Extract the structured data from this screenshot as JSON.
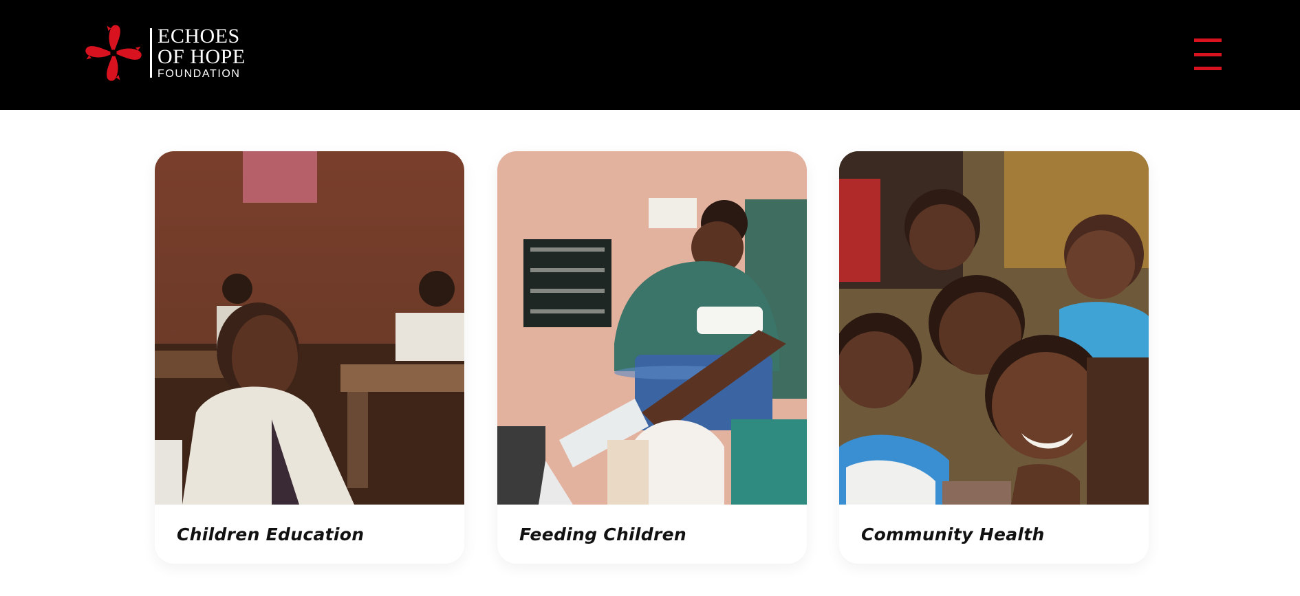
{
  "header": {
    "logo": {
      "line1": "ECHOES",
      "line2": "OF HOPE",
      "line3": "FOUNDATION",
      "icon": "pinwheel-hands-icon",
      "color": "#d8121f"
    },
    "menu_icon": "hamburger-menu-icon",
    "menu_color": "#d8121f",
    "background": "#000000"
  },
  "cards": [
    {
      "title": "Children Education",
      "image": "classroom-photo"
    },
    {
      "title": "Feeding Children",
      "image": "food-distribution-photo"
    },
    {
      "title": "Community Health",
      "image": "smiling-children-photo"
    }
  ]
}
